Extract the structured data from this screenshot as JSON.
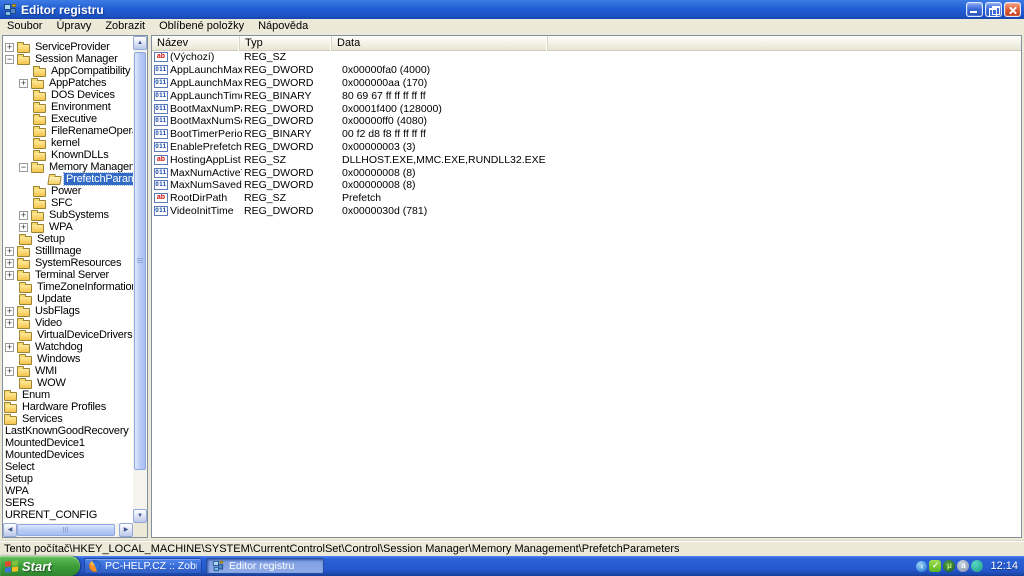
{
  "window": {
    "title": "Editor registru"
  },
  "menu": {
    "items": [
      "Soubor",
      "Úpravy",
      "Zobrazit",
      "Oblíbené položky",
      "Nápověda"
    ]
  },
  "tree": {
    "items": [
      {
        "label": "ServiceProvider",
        "indent": 2,
        "exp": "+",
        "icon": "folder"
      },
      {
        "label": "Session Manager",
        "indent": 2,
        "exp": "-",
        "icon": "folder"
      },
      {
        "label": "AppCompatibility",
        "indent": 30,
        "icon": "folder"
      },
      {
        "label": "AppPatches",
        "indent": 16,
        "exp": "+",
        "icon": "folder"
      },
      {
        "label": "DOS Devices",
        "indent": 30,
        "icon": "folder"
      },
      {
        "label": "Environment",
        "indent": 30,
        "icon": "folder"
      },
      {
        "label": "Executive",
        "indent": 30,
        "icon": "folder"
      },
      {
        "label": "FileRenameOperations",
        "indent": 30,
        "icon": "folder"
      },
      {
        "label": "kernel",
        "indent": 30,
        "icon": "folder"
      },
      {
        "label": "KnownDLLs",
        "indent": 30,
        "icon": "folder"
      },
      {
        "label": "Memory Management",
        "indent": 16,
        "exp": "-",
        "icon": "folder"
      },
      {
        "label": "PrefetchParameters",
        "indent": 45,
        "icon": "folder-open",
        "selected": true
      },
      {
        "label": "Power",
        "indent": 30,
        "icon": "folder"
      },
      {
        "label": "SFC",
        "indent": 30,
        "icon": "folder"
      },
      {
        "label": "SubSystems",
        "indent": 16,
        "exp": "+",
        "icon": "folder"
      },
      {
        "label": "WPA",
        "indent": 16,
        "exp": "+",
        "icon": "folder"
      },
      {
        "label": "Setup",
        "indent": 16,
        "icon": "folder"
      },
      {
        "label": "StillImage",
        "indent": 2,
        "exp": "+",
        "icon": "folder"
      },
      {
        "label": "SystemResources",
        "indent": 2,
        "exp": "+",
        "icon": "folder"
      },
      {
        "label": "Terminal Server",
        "indent": 2,
        "exp": "+",
        "icon": "folder"
      },
      {
        "label": "TimeZoneInformation",
        "indent": 16,
        "icon": "folder"
      },
      {
        "label": "Update",
        "indent": 16,
        "icon": "folder"
      },
      {
        "label": "UsbFlags",
        "indent": 2,
        "exp": "+",
        "icon": "folder"
      },
      {
        "label": "Video",
        "indent": 2,
        "exp": "+",
        "icon": "folder"
      },
      {
        "label": "VirtualDeviceDrivers",
        "indent": 16,
        "icon": "folder"
      },
      {
        "label": "Watchdog",
        "indent": 2,
        "exp": "+",
        "icon": "folder"
      },
      {
        "label": "Windows",
        "indent": 16,
        "icon": "folder"
      },
      {
        "label": "WMI",
        "indent": 2,
        "exp": "+",
        "icon": "folder"
      },
      {
        "label": "WOW",
        "indent": 16,
        "icon": "folder"
      },
      {
        "label": "Enum",
        "indent": 1,
        "icon": "folder"
      },
      {
        "label": "Hardware Profiles",
        "indent": 1,
        "icon": "folder"
      },
      {
        "label": "Services",
        "indent": 1,
        "icon": "folder"
      },
      {
        "label": "LastKnownGoodRecovery",
        "indent": 0
      },
      {
        "label": "MountedDevice1",
        "indent": 0
      },
      {
        "label": "MountedDevices",
        "indent": 0
      },
      {
        "label": "Select",
        "indent": 0
      },
      {
        "label": "Setup",
        "indent": 0
      },
      {
        "label": "WPA",
        "indent": 0
      },
      {
        "label": "SERS",
        "indent": 0
      },
      {
        "label": "URRENT_CONFIG",
        "indent": 0
      }
    ]
  },
  "list": {
    "columns": [
      "Název",
      "Typ",
      "Data"
    ],
    "rows": [
      {
        "icon": "sz",
        "name": "(Výchozí)",
        "type": "REG_SZ",
        "data": ""
      },
      {
        "icon": "bin",
        "name": "AppLaunchMaxN...",
        "type": "REG_DWORD",
        "data": "0x00000fa0 (4000)"
      },
      {
        "icon": "bin",
        "name": "AppLaunchMaxN...",
        "type": "REG_DWORD",
        "data": "0x000000aa (170)"
      },
      {
        "icon": "bin",
        "name": "AppLaunchTimer...",
        "type": "REG_BINARY",
        "data": "80 69 67 ff ff ff ff ff"
      },
      {
        "icon": "bin",
        "name": "BootMaxNumPages",
        "type": "REG_DWORD",
        "data": "0x0001f400 (128000)"
      },
      {
        "icon": "bin",
        "name": "BootMaxNumSect...",
        "type": "REG_DWORD",
        "data": "0x00000ff0 (4080)"
      },
      {
        "icon": "bin",
        "name": "BootTimerPeriod",
        "type": "REG_BINARY",
        "data": "00 f2 d8 f8 ff ff ff ff"
      },
      {
        "icon": "bin",
        "name": "EnablePrefetcher",
        "type": "REG_DWORD",
        "data": "0x00000003 (3)"
      },
      {
        "icon": "sz",
        "name": "HostingAppList",
        "type": "REG_SZ",
        "data": "DLLHOST.EXE,MMC.EXE,RUNDLL32.EXE"
      },
      {
        "icon": "bin",
        "name": "MaxNumActiveTr...",
        "type": "REG_DWORD",
        "data": "0x00000008 (8)"
      },
      {
        "icon": "bin",
        "name": "MaxNumSavedTr...",
        "type": "REG_DWORD",
        "data": "0x00000008 (8)"
      },
      {
        "icon": "sz",
        "name": "RootDirPath",
        "type": "REG_SZ",
        "data": "Prefetch"
      },
      {
        "icon": "bin",
        "name": "VideoInitTime",
        "type": "REG_DWORD",
        "data": "0x0000030d (781)"
      }
    ]
  },
  "status": {
    "path": "Tento počítač\\HKEY_LOCAL_MACHINE\\SYSTEM\\CurrentControlSet\\Control\\Session Manager\\Memory Management\\PrefetchParameters"
  },
  "taskbar": {
    "start_label": "Start",
    "tasks": [
      {
        "label": "PC-HELP.CZ :: Zobra...",
        "icon": "firefox-icon",
        "active": false
      },
      {
        "label": "Editor registru",
        "icon": "regedit-icon",
        "active": true
      }
    ],
    "tray": {
      "icons": [
        "hide-icons-chevron",
        "security-tray-icon",
        "utorrent-tray-icon",
        "messenger-tray-icon",
        "media-player-tray-icon"
      ],
      "time": "12:14"
    }
  },
  "colors": {
    "selection": "#316ac5",
    "titlebar": "#2360d5",
    "taskbar": "#2558cd",
    "start_green": "#3f9e3a"
  }
}
